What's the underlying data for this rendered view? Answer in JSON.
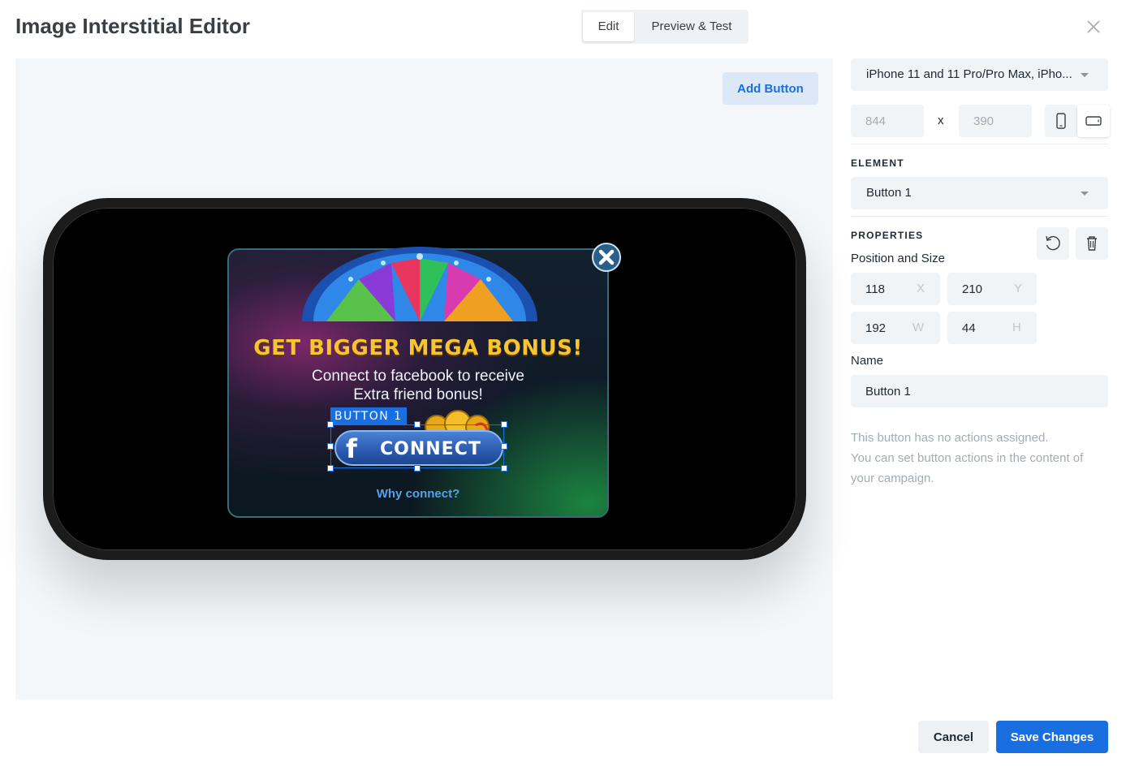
{
  "header": {
    "title": "Image Interstitial Editor",
    "tabs": [
      "Edit",
      "Preview & Test"
    ],
    "active_tab": "Edit",
    "close_icon": "close-icon"
  },
  "canvas": {
    "add_button_label": "Add Button",
    "ad": {
      "headline": "GET BIGGER MEGA BONUS!",
      "line1": "Connect to facebook to receive",
      "line2": "Extra friend bonus!",
      "connect_icon": "f",
      "connect_label": "CONNECT",
      "why_link": "Why connect?"
    },
    "selection_label": "BUTTON 1"
  },
  "panel": {
    "device": "iPhone 11 and 11 Pro/Pro Max, iPho...",
    "width": "844",
    "x_sep": "x",
    "height": "390",
    "orientation": "landscape",
    "element_heading": "ELEMENT",
    "element_value": "Button 1",
    "properties_heading": "PROPERTIES",
    "pos_size_label": "Position and Size",
    "x": {
      "value": "118",
      "suffix": "X"
    },
    "y": {
      "value": "210",
      "suffix": "Y"
    },
    "w": {
      "value": "192",
      "suffix": "W"
    },
    "h": {
      "value": "44",
      "suffix": "H"
    },
    "name_label": "Name",
    "name_value": "Button 1",
    "note_line1": "This button has no actions assigned.",
    "note_line2": "You can set button actions in the content of your campaign."
  },
  "footer": {
    "cancel": "Cancel",
    "save": "Save Changes"
  },
  "colors": {
    "accent": "#1a6fe0",
    "headline": "#f8c531"
  }
}
